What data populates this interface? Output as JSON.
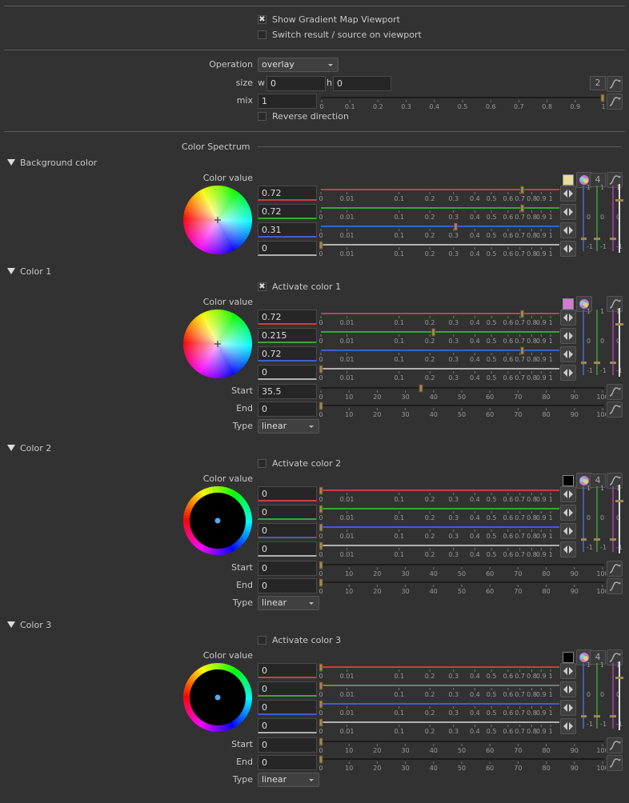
{
  "viewport": {
    "show_gradient_label": "Show Gradient Map Viewport",
    "show_gradient_checked": true,
    "switch_label": "Switch result / source on viewport",
    "switch_checked": false
  },
  "operation": {
    "label": "Operation",
    "value": "overlay",
    "size_label": "size",
    "w_label": "w",
    "w_value": "0",
    "h_label": "h",
    "h_value": "0",
    "dims_value": "2",
    "mix_label": "mix",
    "mix_value": "1",
    "mix_value_num": 1,
    "reverse_label": "Reverse direction",
    "reverse_checked": false
  },
  "spectrum_title": "Color Spectrum",
  "ticks_01": [
    "0",
    "0.1",
    "0.2",
    "0.3",
    "0.4",
    "0.5",
    "0.6",
    "0.7",
    "0.8",
    "0.9",
    "1"
  ],
  "ticks_log": [
    "0",
    "0.01",
    "0.1",
    "0.2",
    "0.3",
    "0.4",
    "0.5",
    "0.6",
    "0.7",
    "0.8",
    "0.9",
    "1"
  ],
  "ticks_100": [
    "0",
    "10",
    "20",
    "30",
    "40",
    "50",
    "60",
    "70",
    "80",
    "90",
    "100"
  ],
  "channel_bar_ticks": [
    "1",
    "0",
    "-1"
  ],
  "channel_colors": [
    "#c84040",
    "#40a040",
    "#4060c8",
    "#b0b0b0"
  ],
  "sections": [
    {
      "key": "bg",
      "title": "Background color",
      "color_value_label": "Color value",
      "swatch": "#e8dc9e",
      "channel_count": "4",
      "channels": [
        "0.72",
        "0.72",
        "0.31",
        "0"
      ],
      "channels_num": [
        0.72,
        0.72,
        0.31,
        0
      ],
      "wheel": "bright"
    },
    {
      "key": "c1",
      "title": "Color 1",
      "activate_label": "Activate color 1",
      "activate_checked": true,
      "color_value_label": "Color value",
      "swatch": "#d27ad4",
      "channels": [
        "0.72",
        "0.215",
        "0.72",
        "0"
      ],
      "channels_num": [
        0.72,
        0.215,
        0.72,
        0
      ],
      "wheel": "bright",
      "start_label": "Start",
      "start_value": "35.5",
      "start_num": 35.5,
      "end_label": "End",
      "end_value": "0",
      "end_num": 0,
      "type_label": "Type",
      "type_value": "linear"
    },
    {
      "key": "c2",
      "title": "Color 2",
      "activate_label": "Activate color 2",
      "activate_checked": false,
      "color_value_label": "Color value",
      "swatch": "#000000",
      "channel_count": "4",
      "channels": [
        "0",
        "0",
        "0",
        "0"
      ],
      "channels_num": [
        0,
        0,
        0,
        0
      ],
      "wheel": "dark",
      "start_label": "Start",
      "start_value": "0",
      "start_num": 0,
      "end_label": "End",
      "end_value": "0",
      "end_num": 0,
      "type_label": "Type",
      "type_value": "linear"
    },
    {
      "key": "c3",
      "title": "Color 3",
      "activate_label": "Activate color 3",
      "activate_checked": false,
      "color_value_label": "Color value",
      "swatch": "#000000",
      "channel_count": "4",
      "channels": [
        "0",
        "0",
        "0",
        "0"
      ],
      "channels_num": [
        0,
        0,
        0,
        0
      ],
      "wheel": "dark",
      "start_label": "Start",
      "start_value": "0",
      "start_num": 0,
      "end_label": "End",
      "end_value": "0",
      "end_num": 0,
      "type_label": "Type",
      "type_value": "linear"
    }
  ]
}
